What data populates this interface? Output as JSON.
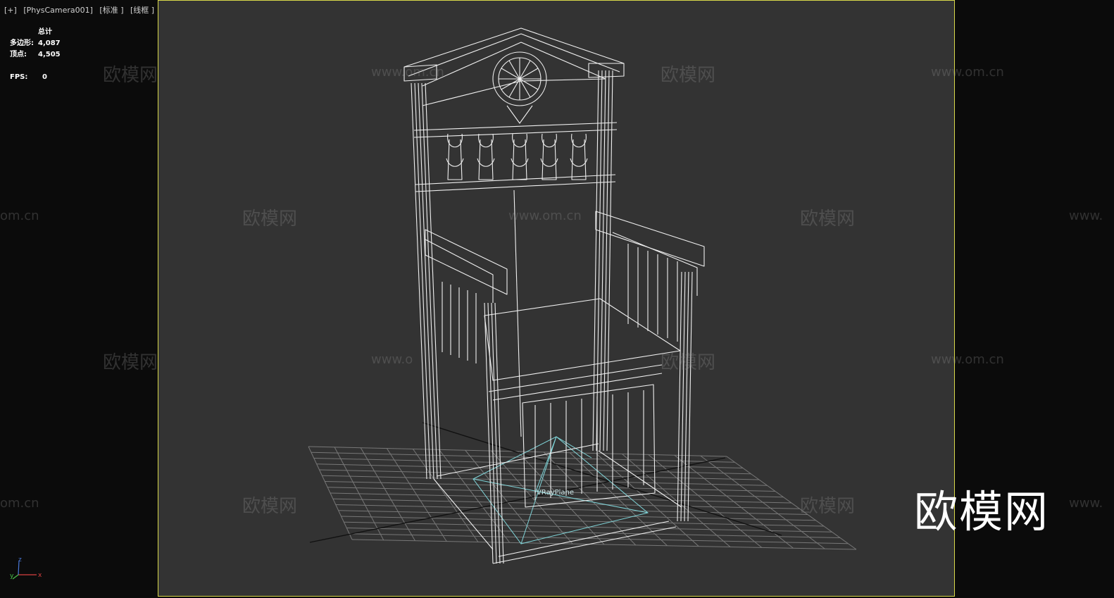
{
  "viewport": {
    "label_parts": [
      "[+]",
      "[PhysCamera001]",
      "[标准 ]",
      "[线框 ]"
    ]
  },
  "stats": {
    "header": "总计",
    "polygons_label": "多边形:",
    "polygons_value": "4,087",
    "vertices_label": "顶点:",
    "vertices_value": "4,505",
    "fps_label": "FPS:",
    "fps_value": "0"
  },
  "scene": {
    "object_label": "VRayPlane"
  },
  "watermark": {
    "brand": "欧模网",
    "url": "www.om.cn",
    "url_partial_left": "om.cn",
    "url_partial_right": "www.",
    "url_partial_mid": "www.o"
  },
  "axis": {
    "x": "x",
    "y": "y",
    "z": "z"
  },
  "colors": {
    "background": "#0b0b0b",
    "viewport": "#333333",
    "safe_frame": "#d8d84a",
    "wireframe": "#f2f2f2",
    "grid": "#7a7a7a",
    "plane": "#7fd4d8"
  }
}
